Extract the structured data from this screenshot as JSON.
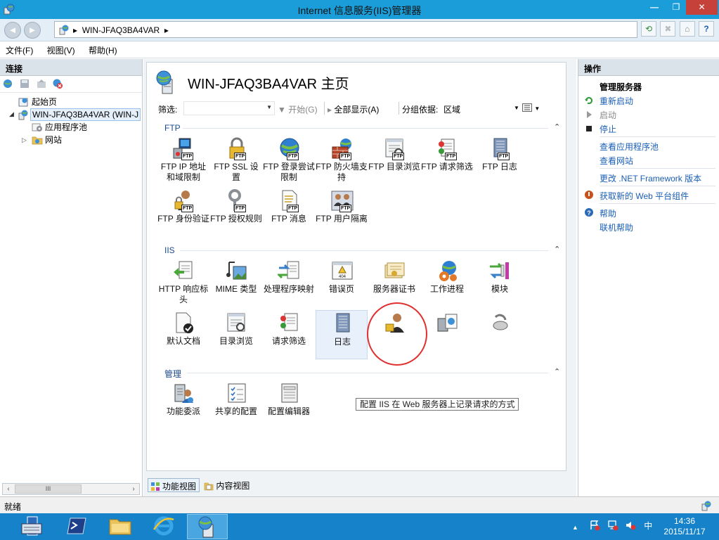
{
  "window": {
    "title": "Internet 信息服务(IIS)管理器",
    "min_label": "—",
    "max_label": "❐",
    "close_label": "✕"
  },
  "address": {
    "back_label": "◄",
    "forward_label": "►",
    "path": "WIN-JFAQ3BA4VAR",
    "arrow": "▸",
    "help_label": "?"
  },
  "menu": [
    "文件(F)",
    "视图(V)",
    "帮助(H)"
  ],
  "left_pane": {
    "title": "连接",
    "tree": [
      {
        "label": "起始页",
        "expander": ""
      },
      {
        "label": "WIN-JFAQ3BA4VAR (WIN-J",
        "expander": "◢"
      },
      {
        "label": "应用程序池",
        "expander": ""
      },
      {
        "label": "网站",
        "expander": "▷"
      }
    ],
    "scroll_left": "‹",
    "scroll_right": "›",
    "scroll_grip": "III"
  },
  "center": {
    "page_title": "WIN-JFAQ3BA4VAR 主页",
    "filter_label": "筛选:",
    "start_label": "开始(G)",
    "show_all_label": "全部显示(A)",
    "group_by_label": "分组依据:",
    "group_by_value": "区域",
    "groups": [
      {
        "name": "FTP"
      },
      {
        "name": "IIS"
      },
      {
        "name": "管理"
      }
    ],
    "ftp_features": [
      {
        "label": "FTP IP 地址和域限制"
      },
      {
        "label": "FTP SSL 设置"
      },
      {
        "label": "FTP 登录尝试限制"
      },
      {
        "label": "FTP 防火墙支持"
      },
      {
        "label": "FTP 目录浏览"
      },
      {
        "label": "FTP 请求筛选"
      },
      {
        "label": "FTP 日志"
      },
      {
        "label": "FTP 身份验证"
      },
      {
        "label": "FTP 授权规则"
      },
      {
        "label": "FTP 消息"
      },
      {
        "label": "FTP 用户隔离"
      }
    ],
    "iis_features": [
      {
        "label": "HTTP 响应标头"
      },
      {
        "label": "MIME 类型"
      },
      {
        "label": "处理程序映射"
      },
      {
        "label": "错误页"
      },
      {
        "label": "服务器证书"
      },
      {
        "label": "工作进程"
      },
      {
        "label": "模块"
      },
      {
        "label": "默认文档"
      },
      {
        "label": "目录浏览"
      },
      {
        "label": "请求筛选"
      },
      {
        "label": "日志"
      }
    ],
    "mgmt_features": [
      {
        "label": "功能委派"
      },
      {
        "label": "共享的配置"
      },
      {
        "label": "配置编辑器"
      }
    ],
    "badge": "FTP",
    "error_code": "404",
    "tooltip": "配置 IIS 在 Web 服务器上记录请求的方式",
    "tabs": {
      "features": "功能视图",
      "content": "内容视图"
    }
  },
  "actions": {
    "title": "操作",
    "manage_server": "管理服务器",
    "restart": "重新启动",
    "start": "启动",
    "stop": "停止",
    "view_app_pools": "查看应用程序池",
    "view_sites": "查看网站",
    "change_framework": "更改 .NET Framework 版本",
    "get_web_components": "获取新的 Web 平台组件",
    "help": "帮助",
    "online_help": "联机帮助"
  },
  "status": {
    "text": "就绪"
  },
  "taskbar": {
    "time": "14:36",
    "date": "2015/11/17",
    "ime": "中",
    "tray_up": "▲"
  },
  "colors": {
    "titlebar": "#1a9dd8",
    "taskbar": "#1682c9",
    "link": "#1a5fb4",
    "close": "#c7413b",
    "annotation": "#e03030"
  }
}
